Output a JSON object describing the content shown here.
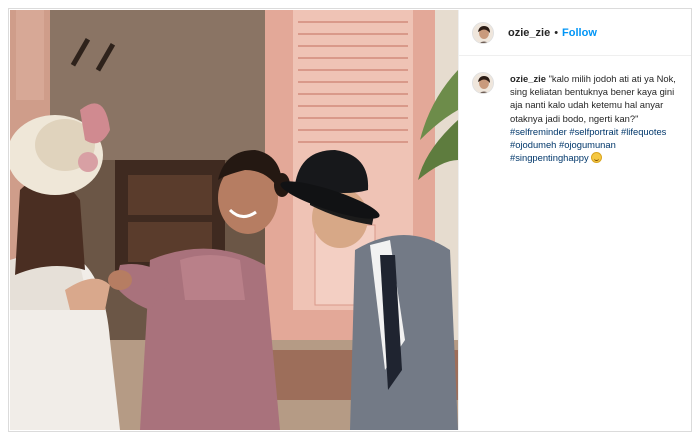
{
  "post": {
    "username": "ozie_zie",
    "separator": "•",
    "follow_label": "Follow"
  },
  "caption": {
    "username": "ozie_zie",
    "text": "\"kalo milih jodoh ati ati ya Nok, sing keliatan bentuknya bener kaya gini aja nanti kalo udah ketemu hal anyar otaknya jadi bodo, ngerti kan?\"",
    "hashtags": [
      "#selfreminder",
      "#selfportrait",
      "#lifequotes",
      "#ojodumeh",
      "#ojogumunan",
      "#singpentinghappy"
    ],
    "emoji": "laughing-face"
  },
  "colors": {
    "accent": "#0095f6",
    "hashtag": "#00376b"
  }
}
